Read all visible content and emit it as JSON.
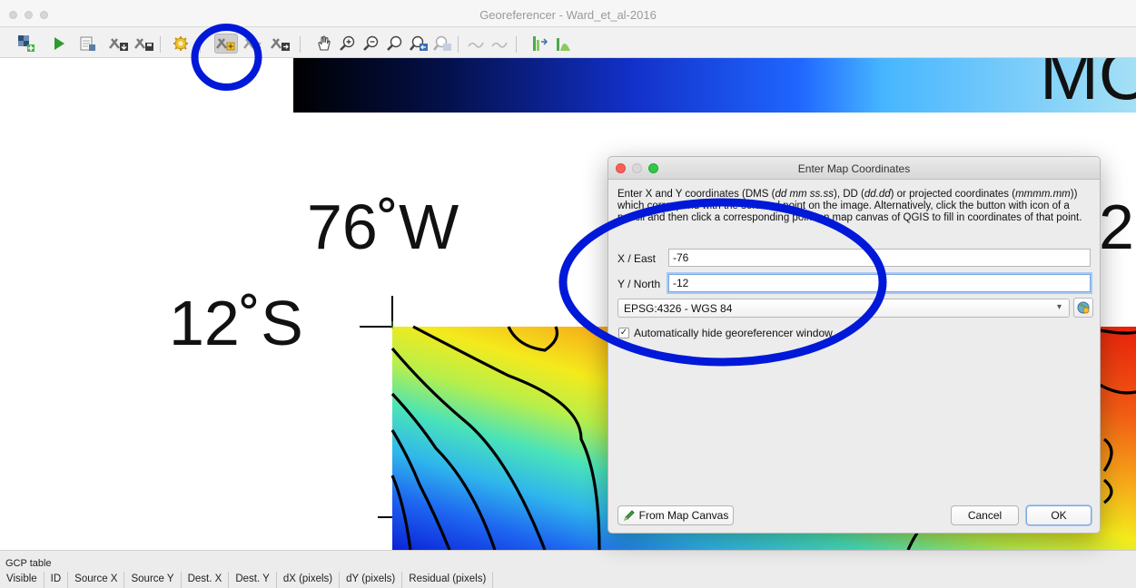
{
  "window": {
    "title": "Georeferencer - Ward_et_al-2016"
  },
  "toolbar": {
    "icons": [
      "open-raster-icon",
      "start-georeferencing-icon",
      "generate-gdal-script-icon",
      "load-gcp-points-icon",
      "save-gcp-points-icon",
      "transformation-settings-icon",
      "add-point-icon",
      "delete-point-icon",
      "move-gcp-point-icon",
      "pan-icon",
      "zoom-in-icon",
      "zoom-out-icon",
      "zoom-to-layer-icon",
      "zoom-last-icon",
      "zoom-next-icon",
      "link-georeferencer-to-qgis-icon",
      "link-qgis-to-georeferencer-icon",
      "raster-properties-icon",
      "histogram-stretch-icon"
    ]
  },
  "canvas": {
    "labels": {
      "lon": "76˚W",
      "lat": "12˚S",
      "right_digit": "2",
      "top_text": "MO"
    },
    "colors": {
      "contour": "#000000",
      "background": "#ffffff"
    }
  },
  "dialog": {
    "title": "Enter Map Coordinates",
    "instructions": {
      "part1": "Enter X and Y coordinates (DMS (",
      "dms": "dd mm ss.ss",
      "part2": "), DD (",
      "dd": "dd.dd",
      "part3": ") or projected coordinates (",
      "proj": "mmmm.mm",
      "part4": ")) which correspond with the selected point on the image. Alternatively, click the button with icon of a pencil and then click a corresponding point on map canvas of QGIS to fill in coordinates of that point."
    },
    "x_label": "X / East",
    "x_value": "-76",
    "y_label": "Y / North",
    "y_value": "-12",
    "crs": "EPSG:4326 - WGS 84",
    "auto_hide_label": "Automatically hide georeferencer window",
    "auto_hide_checked": true,
    "check_mark": "✓",
    "from_map_canvas": "From Map Canvas",
    "cancel": "Cancel",
    "ok": "OK"
  },
  "gcp_table": {
    "title": "GCP table",
    "columns": [
      "Visible",
      "ID",
      "Source X",
      "Source Y",
      "Dest. X",
      "Dest. Y",
      "dX (pixels)",
      "dY (pixels)",
      "Residual (pixels)"
    ]
  },
  "annotation_color": "#0019d9"
}
